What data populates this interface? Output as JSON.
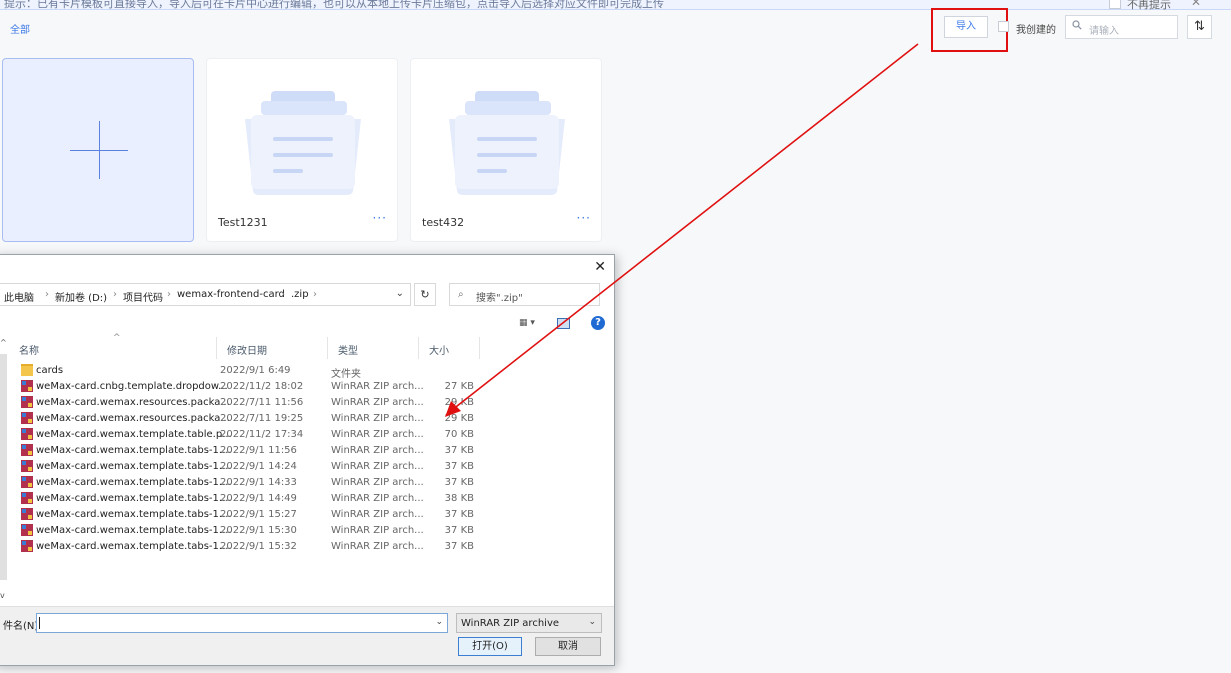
{
  "banner": {
    "text": "提示：已有卡片模板可直接导入，导入后可在卡片中心进行编辑，也可以从本地上传卡片压缩包，点击导入后选择对应文件即可完成上传",
    "no_more": "不再提示"
  },
  "tabs": {
    "all": "全部"
  },
  "toolbar": {
    "import_label": "导入",
    "mine_label": "我创建的",
    "search_placeholder": "请输入",
    "sort_icon": "⇅"
  },
  "cards": [
    {
      "name": "Test1231",
      "more": "···"
    },
    {
      "name": "test432",
      "more": "···"
    }
  ],
  "dialog": {
    "close": "✕",
    "path": [
      "此电脑",
      "新加卷 (D:)",
      "项目代码",
      "wemax-frontend-card",
      ".zip"
    ],
    "search_placeholder": "搜索\".zip\"",
    "columns": {
      "name": "名称",
      "date": "修改日期",
      "type": "类型",
      "size": "大小"
    },
    "files": [
      {
        "name": "cards",
        "date": "2022/9/1 6:49",
        "type": "文件夹",
        "size": "",
        "kind": "folder"
      },
      {
        "name": "weMax-card.cnbg.template.dropdow...",
        "date": "2022/11/2 18:02",
        "type": "WinRAR ZIP arch...",
        "size": "27 KB",
        "kind": "zip"
      },
      {
        "name": "weMax-card.wemax.resources.packa...",
        "date": "2022/7/11 11:56",
        "type": "WinRAR ZIP arch...",
        "size": "29 KB",
        "kind": "zip"
      },
      {
        "name": "weMax-card.wemax.resources.packa...",
        "date": "2022/7/11 19:25",
        "type": "WinRAR ZIP arch...",
        "size": "29 KB",
        "kind": "zip"
      },
      {
        "name": "weMax-card.wemax.template.table.p...",
        "date": "2022/11/2 17:34",
        "type": "WinRAR ZIP arch...",
        "size": "70 KB",
        "kind": "zip"
      },
      {
        "name": "weMax-card.wemax.template.tabs-1....",
        "date": "2022/9/1 11:56",
        "type": "WinRAR ZIP arch...",
        "size": "37 KB",
        "kind": "zip"
      },
      {
        "name": "weMax-card.wemax.template.tabs-1....",
        "date": "2022/9/1 14:24",
        "type": "WinRAR ZIP arch...",
        "size": "37 KB",
        "kind": "zip"
      },
      {
        "name": "weMax-card.wemax.template.tabs-1....",
        "date": "2022/9/1 14:33",
        "type": "WinRAR ZIP arch...",
        "size": "37 KB",
        "kind": "zip"
      },
      {
        "name": "weMax-card.wemax.template.tabs-1....",
        "date": "2022/9/1 14:49",
        "type": "WinRAR ZIP arch...",
        "size": "38 KB",
        "kind": "zip"
      },
      {
        "name": "weMax-card.wemax.template.tabs-1....",
        "date": "2022/9/1 15:27",
        "type": "WinRAR ZIP arch...",
        "size": "37 KB",
        "kind": "zip"
      },
      {
        "name": "weMax-card.wemax.template.tabs-1....",
        "date": "2022/9/1 15:30",
        "type": "WinRAR ZIP arch...",
        "size": "37 KB",
        "kind": "zip"
      },
      {
        "name": "weMax-card.wemax.template.tabs-1....",
        "date": "2022/9/1 15:32",
        "type": "WinRAR ZIP arch...",
        "size": "37 KB",
        "kind": "zip"
      }
    ],
    "filename_label": "件名(N):",
    "filename_value": "",
    "filetype": "WinRAR ZIP archive",
    "open_label": "打开(O)",
    "cancel_label": "取消"
  },
  "colors": {
    "accent": "#3b78e7",
    "annotation": "#e01010"
  }
}
